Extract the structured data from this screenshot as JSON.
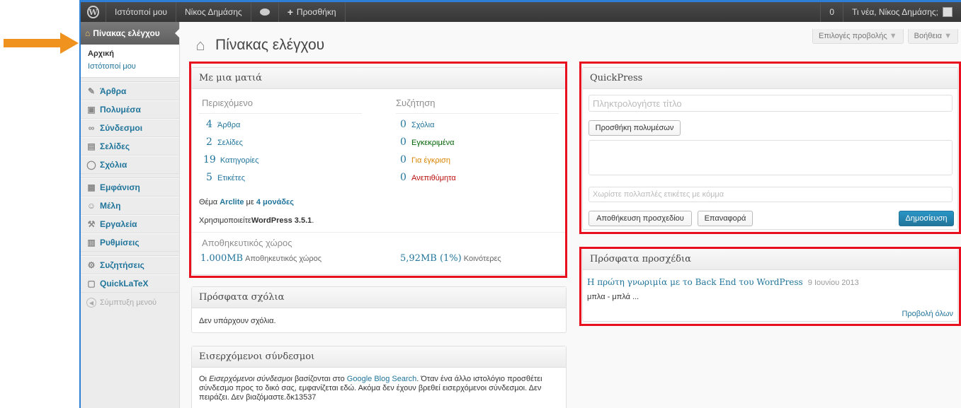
{
  "adminbar": {
    "my_sites": "Ιστότοποί μου",
    "site_name": "Νίκος Δημάσης",
    "comments_count": "",
    "new_label": "Προσθήκη",
    "updates_count": "0",
    "greeting": "Τι νέα, Νίκος Δημάσης;"
  },
  "sidebar": {
    "current": "Πίνακας ελέγχου",
    "submenu": [
      "Αρχική",
      "Ιστότοποί μου"
    ],
    "items": [
      {
        "label": "Άρθρα",
        "icon": "pin-icon"
      },
      {
        "label": "Πολυμέσα",
        "icon": "media-icon"
      },
      {
        "label": "Σύνδεσμοι",
        "icon": "link-icon"
      },
      {
        "label": "Σελίδες",
        "icon": "page-icon"
      },
      {
        "label": "Σχόλια",
        "icon": "comment-icon"
      },
      {
        "label": "Εμφάνιση",
        "icon": "appearance-icon"
      },
      {
        "label": "Μέλη",
        "icon": "users-icon"
      },
      {
        "label": "Εργαλεία",
        "icon": "tools-icon"
      },
      {
        "label": "Ρυθμίσεις",
        "icon": "settings-icon"
      },
      {
        "label": "Συζητήσεις",
        "icon": "discussion-icon"
      },
      {
        "label": "QuickLaTeX",
        "icon": "latex-icon"
      }
    ],
    "collapse": "Σύμπτυξη μενού"
  },
  "screen_options": "Επιλογές προβολής",
  "help": "Βοήθεια",
  "page_title": "Πίνακας ελέγχου",
  "right_now": {
    "title": "Με μια ματιά",
    "content_header": "Περιεχόμενο",
    "discussion_header": "Συζήτηση",
    "content": [
      {
        "num": "4",
        "label": "Άρθρα"
      },
      {
        "num": "2",
        "label": "Σελίδες"
      },
      {
        "num": "19",
        "label": "Κατηγορίες"
      },
      {
        "num": "5",
        "label": "Ετικέτες"
      }
    ],
    "discussion": [
      {
        "num": "0",
        "label": "Σχόλια"
      },
      {
        "num": "0",
        "label": "Εγκεκριμένα"
      },
      {
        "num": "0",
        "label": "Για έγκριση"
      },
      {
        "num": "0",
        "label": "Ανεπιθύμητα"
      }
    ],
    "theme_prefix": "Θέμα",
    "theme_name": "Arclite",
    "theme_mid": "με",
    "widgets": "4 μονάδες",
    "using_prefix": "Χρησιμοποιείτε",
    "wp_version": "WordPress 3.5.1",
    "storage_title": "Αποθηκευτικός χώρος",
    "storage_total": "1.000MB",
    "storage_total_label": "Αποθηκευτικός χώρος",
    "storage_used": "5,92MB (1%)",
    "storage_used_label": "Κοινότερες"
  },
  "recent_comments": {
    "title": "Πρόσφατα σχόλια",
    "empty": "Δεν υπάρχουν σχόλια."
  },
  "incoming_links": {
    "title": "Εισερχόμενοι σύνδεσμοι",
    "text_a": "Οι",
    "text_em": "Εισερχόμενοι σύνδεσμοι",
    "text_b": "βασίζονται στο",
    "link": "Google Blog Search",
    "text_c": ". Όταν ένα άλλο ιστολόγιο προσθέτει",
    "line2": "σύνδεσμο προς το δικό σας, εμφανίζεται εδώ. Ακόμα δεν έχουν βρεθεί εισερχόμενοι σύνδεσμοι. Δεν",
    "line3": "πειράζει. Δεν βιαζόμαστε.δκ13537"
  },
  "quickpress": {
    "title": "QuickPress",
    "title_placeholder": "Πληκτρολογήστε τίτλο",
    "add_media": "Προσθήκη πολυμέσων",
    "tags_placeholder": "Χωρίστε πολλαπλές ετικέτες με κόμμα",
    "save_draft": "Αποθήκευση προσχεδίου",
    "reset": "Επαναφορά",
    "publish": "Δημοσίευση"
  },
  "recent_drafts": {
    "title": "Πρόσφατα προσχέδια",
    "draft_title": "Η πρώτη γνωριμία με το Back End του WordPress",
    "draft_date": "9 Ιουνίου 2013",
    "excerpt": "μπλα - μπλά ...",
    "view_all": "Προβολή όλων"
  },
  "colors": {
    "accent": "#21759b",
    "highlight": "#e8101e",
    "arrow": "#f0921e",
    "adminbar": "#464646"
  }
}
